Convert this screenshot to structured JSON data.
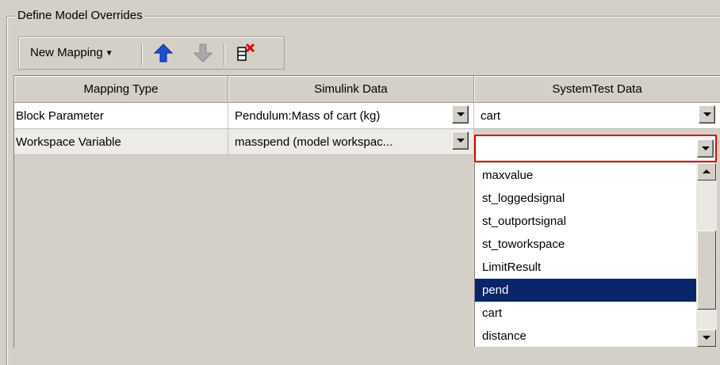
{
  "group": {
    "title": "Define Model Overrides"
  },
  "toolbar": {
    "new_mapping_label": "New Mapping",
    "icons": [
      "up-arrow-icon",
      "down-arrow-icon",
      "delete-mapping-icon"
    ],
    "colors": {
      "up_arrow": "#1f4fd3",
      "down_arrow": "#a8a8a8",
      "delete_x": "#e00000"
    }
  },
  "table": {
    "headers": [
      "Mapping Type",
      "Simulink Data",
      "SystemTest Data"
    ],
    "rows": [
      {
        "mapping_type": "Block Parameter",
        "simulink_data": "Pendulum:Mass of cart (kg)",
        "systemtest_data": "cart"
      },
      {
        "mapping_type": "Workspace Variable",
        "simulink_data": "masspend  (model workspac...",
        "systemtest_data": ""
      }
    ]
  },
  "dropdown": {
    "items": [
      "maxvalue",
      "st_loggedsignal",
      "st_outportsignal",
      "st_toworkspace",
      "LimitResult",
      "pend",
      "cart",
      "distance"
    ],
    "selected_index": 5,
    "colors": {
      "selection": "#0a246a",
      "focus_border": "#e00000"
    }
  }
}
